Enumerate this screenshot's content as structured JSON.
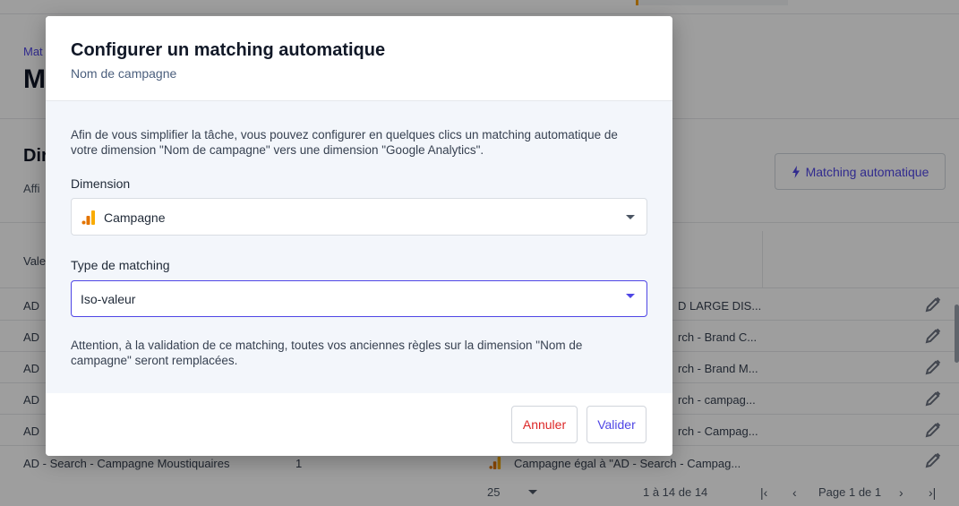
{
  "background": {
    "breadcrumb": "Mat",
    "page_title": "M",
    "section_title": "Dir",
    "section_subtitle": "Affi",
    "auto_button_label": "Matching automatique",
    "table_header_value": "Vale",
    "rows": [
      {
        "left": "AD",
        "right": "D LARGE DIS..."
      },
      {
        "left": "AD",
        "right": "rch - Brand C..."
      },
      {
        "left": "AD",
        "right": "rch - Brand M..."
      },
      {
        "left": "AD",
        "right": "rch - campag..."
      },
      {
        "left": "AD",
        "right": "rch - Campag..."
      },
      {
        "left": "AD - Search - Campagne Moustiquaires",
        "mid": "1",
        "right": "Campagne égal à \"AD - Search - Campag..."
      }
    ],
    "pager": {
      "per_page": "25",
      "range": "1 à 14 de 14",
      "page": "Page 1 de 1"
    }
  },
  "modal": {
    "title": "Configurer un matching automatique",
    "subtitle": "Nom de campagne",
    "intro": "Afin de vous simplifier la tâche, vous pouvez configurer en quelques clics un matching automatique de votre dimension \"Nom de campagne\" vers une dimension \"Google Analytics\".",
    "dimension_label": "Dimension",
    "dimension_value": "Campagne",
    "type_label": "Type de matching",
    "type_value": "Iso-valeur",
    "warning": "Attention, à la validation de ce matching, toutes vos anciennes règles sur la dimension \"Nom de campagne\" seront remplacées.",
    "cancel_label": "Annuler",
    "validate_label": "Valider"
  },
  "colors": {
    "accent": "#4f46e5",
    "danger": "#dc2626",
    "ga_orange": "#f9ab00",
    "ga_dark_orange": "#e37400"
  }
}
